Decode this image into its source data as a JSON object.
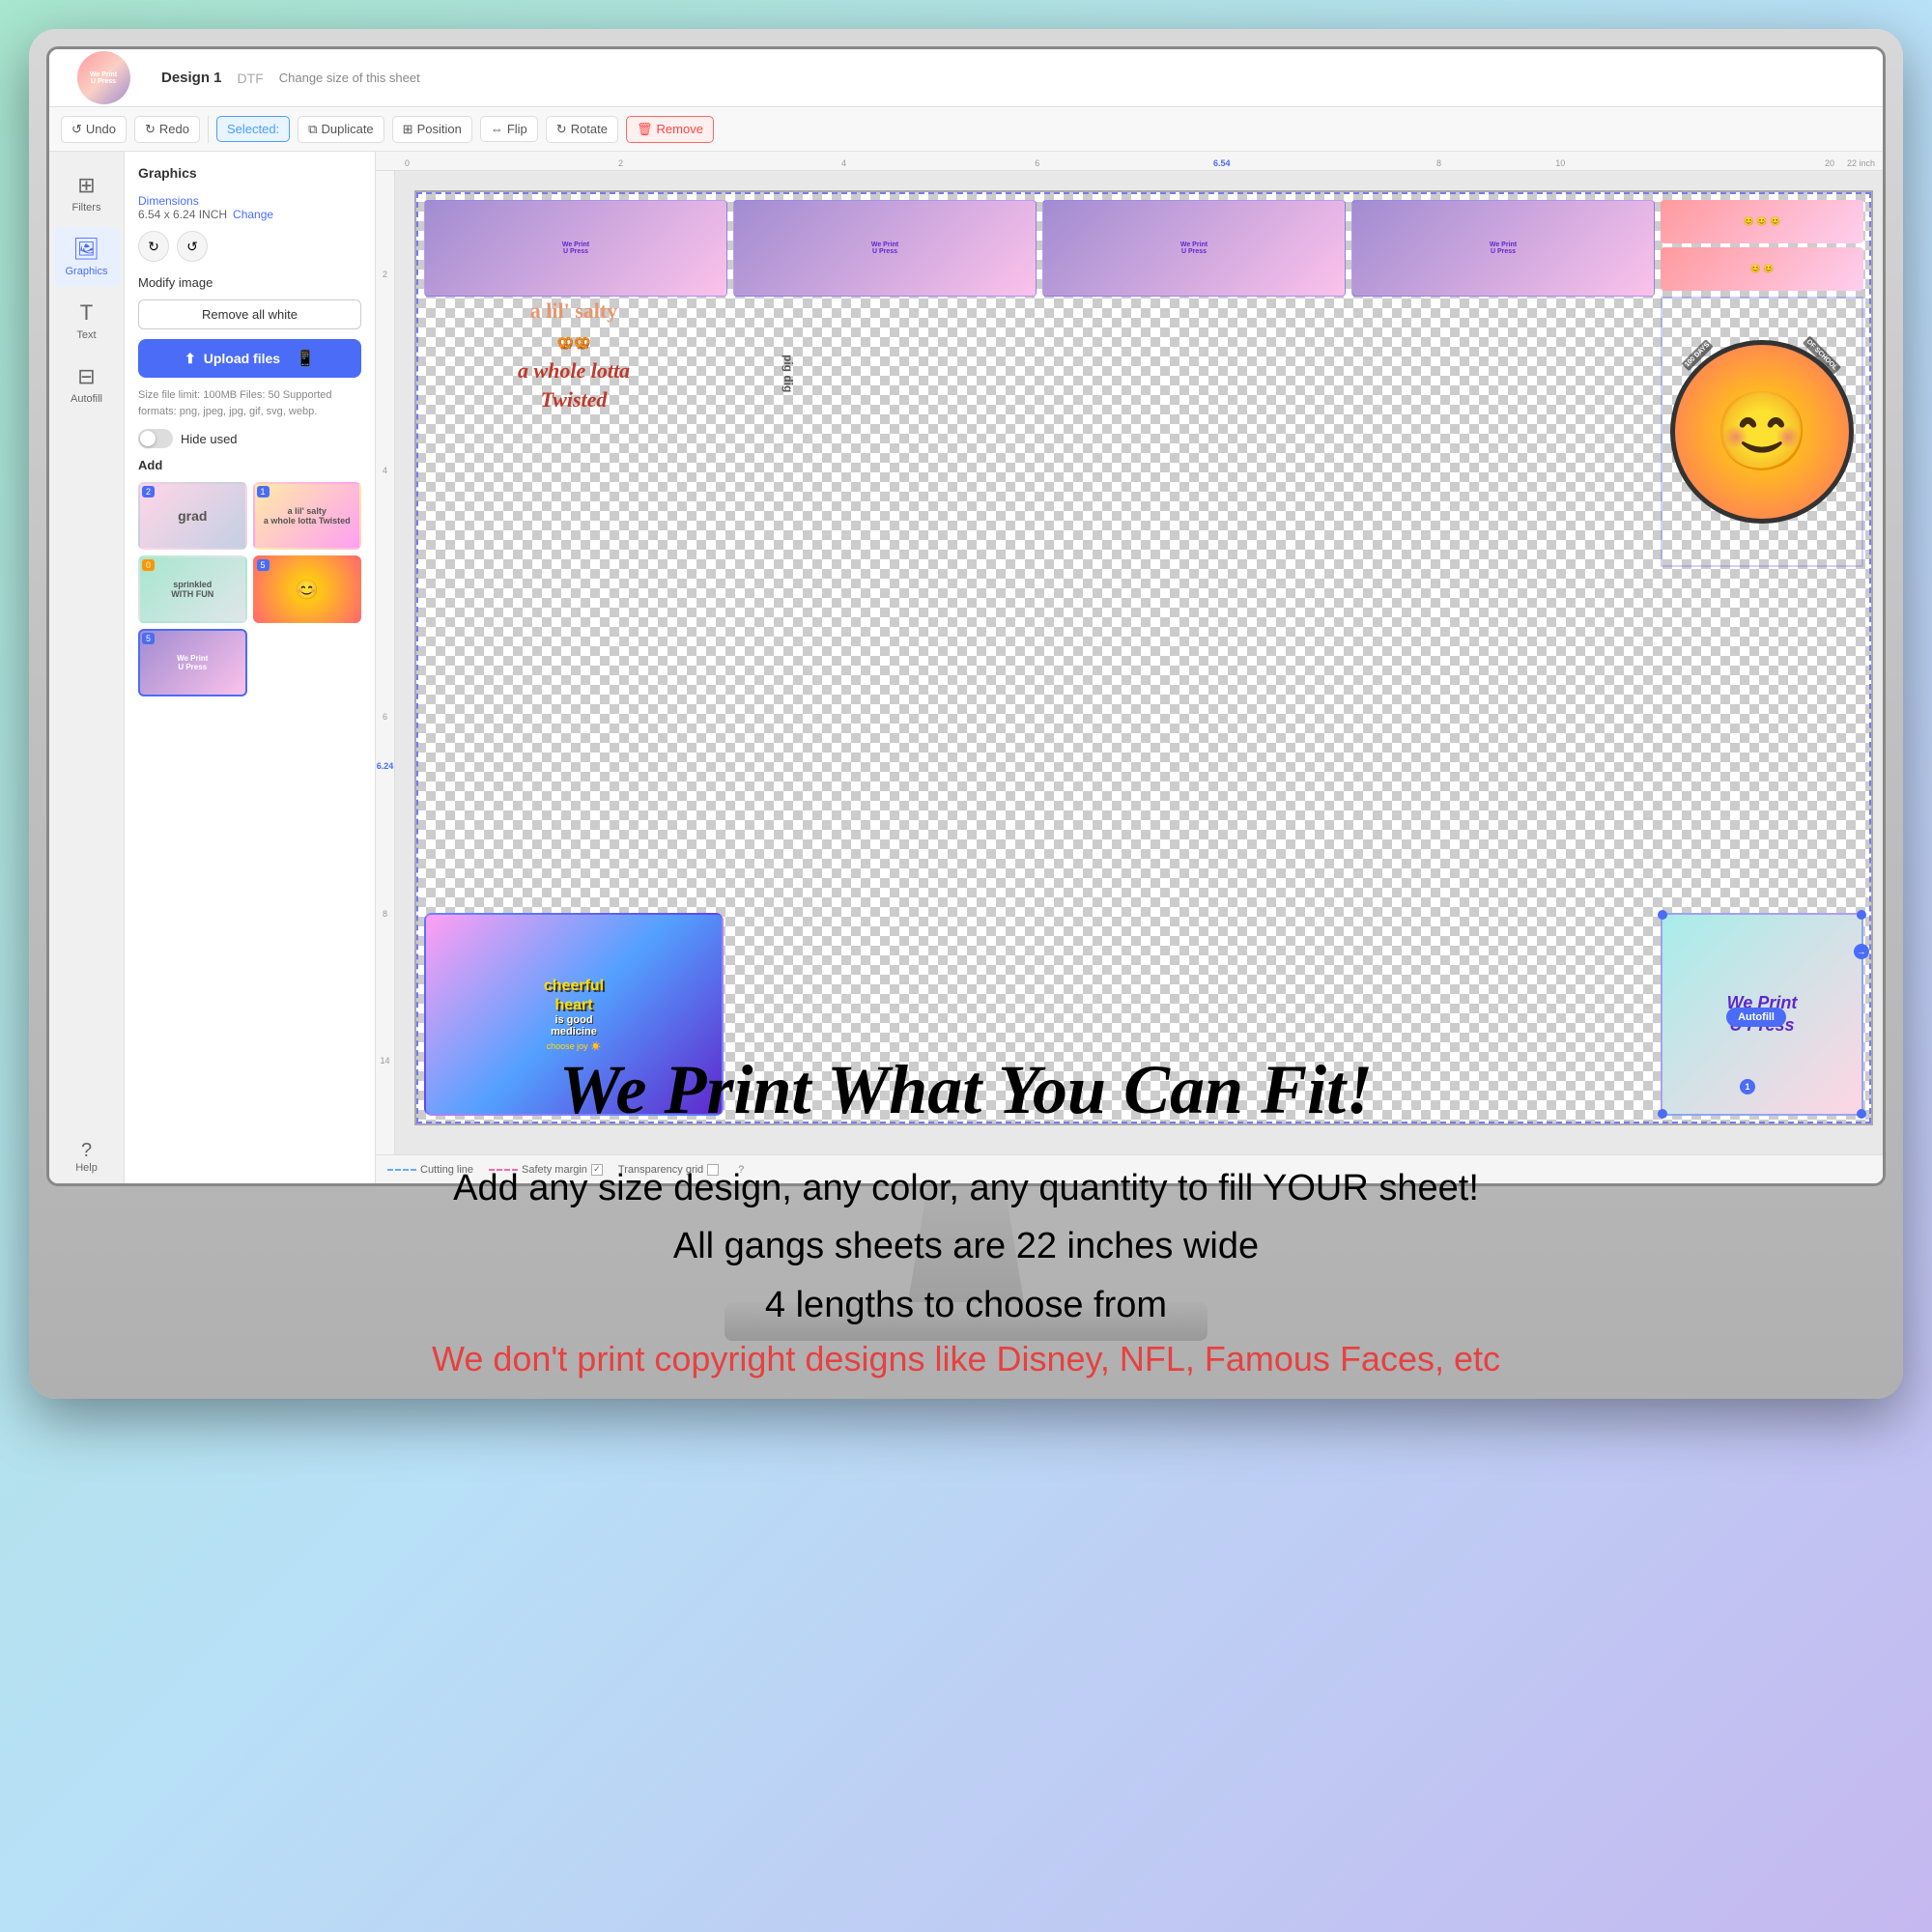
{
  "monitor": {
    "screen": {
      "header": {
        "logo_text": "We Print U Press",
        "design_title": "Design 1",
        "design_type": "DTF",
        "change_size_label": "Change size of this sheet"
      },
      "toolbar": {
        "undo_label": "Undo",
        "redo_label": "Redo",
        "selected_label": "Selected:",
        "duplicate_label": "Duplicate",
        "position_label": "Position",
        "flip_label": "Flip",
        "rotate_label": "Rotate",
        "remove_label": "Remove"
      },
      "left_sidebar": {
        "items": [
          {
            "id": "filters",
            "label": "Filters",
            "icon": "⊞"
          },
          {
            "id": "graphics",
            "label": "Graphics",
            "icon": "🖼"
          },
          {
            "id": "text",
            "label": "Text",
            "icon": "T"
          },
          {
            "id": "autofill",
            "label": "Autofill",
            "icon": "⊟"
          }
        ],
        "help_label": "Help"
      },
      "panel": {
        "section_title": "Graphics",
        "dimensions_label": "Dimensions",
        "dimensions_value": "6.54 x 6.24 INCH",
        "change_label": "Change",
        "modify_image_label": "Modify image",
        "remove_all_white_label": "Remove all white",
        "upload_btn_label": "Upload files",
        "upload_size_limit": "Size file limit: 100MB Files: 50 Supported formats: png, jpeg, jpg, gif, svg, webp.",
        "hide_used_label": "Hide used",
        "add_label": "Add",
        "thumbnail_badges": [
          "2",
          "1",
          "0",
          "5",
          "5"
        ]
      },
      "canvas": {
        "ruler_value": "6.54",
        "inch_label": "22 inch"
      },
      "bottom_bar": {
        "cutting_line_label": "Cutting line",
        "safety_margin_label": "Safety margin",
        "transparency_grid_label": "Transparency grid"
      }
    }
  },
  "headline": {
    "text": "We Print What You Can Fit!"
  },
  "body_lines": [
    "Add any size design, any color, any quantity to fill YOUR sheet!",
    "All gangs sheets are 22 inches wide",
    "4 lengths to choose from"
  ],
  "copyright_line": "We don't print copyright designs like Disney, NFL, Famous Faces, etc"
}
